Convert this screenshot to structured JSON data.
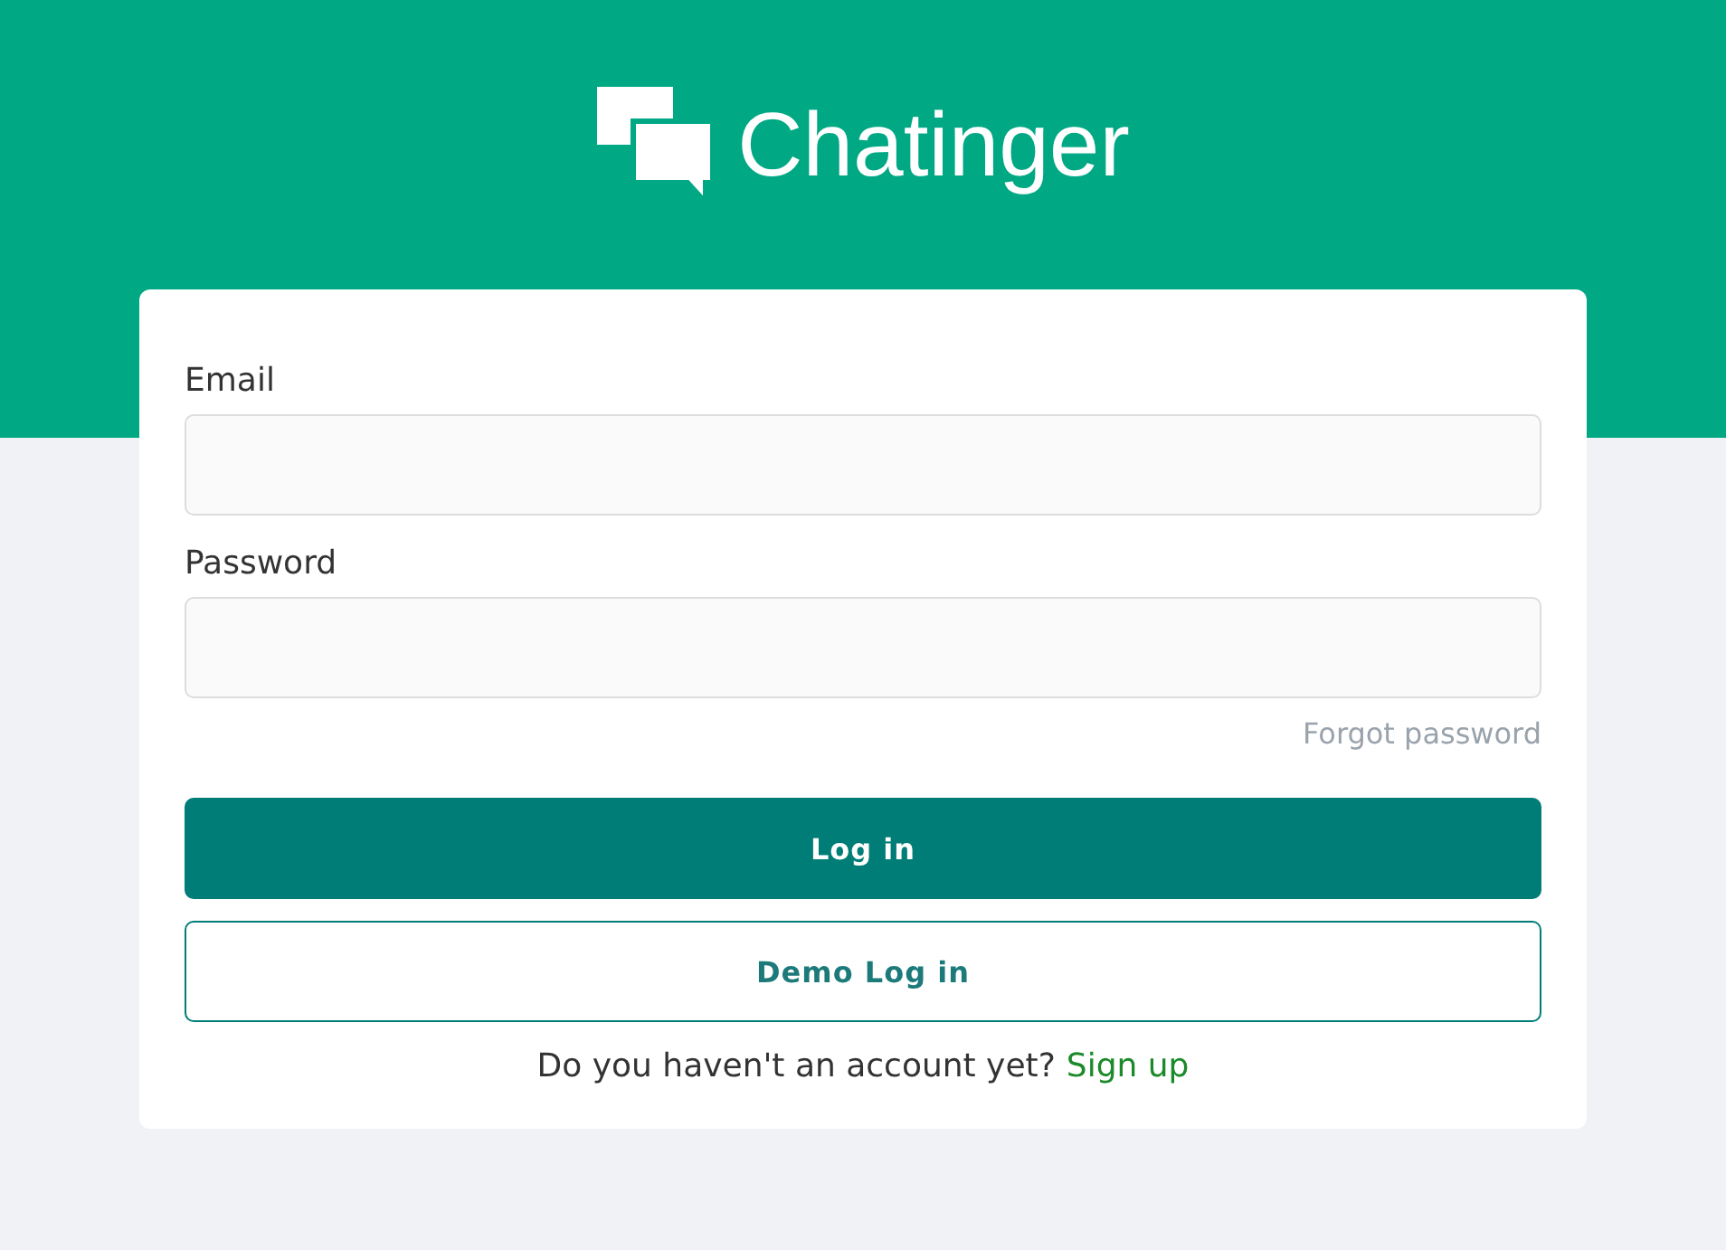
{
  "brand": {
    "name": "Chatinger"
  },
  "fields": [
    {
      "label": "Email"
    },
    {
      "label": "Password"
    }
  ],
  "forgot_link": "Forgot password",
  "buttons": [
    {
      "label": "Log in",
      "kind": "primary"
    },
    {
      "label": "Demo Log in",
      "kind": "outline"
    }
  ],
  "signup": {
    "prompt": "Do you haven't an account yet?",
    "link": "Sign up"
  }
}
